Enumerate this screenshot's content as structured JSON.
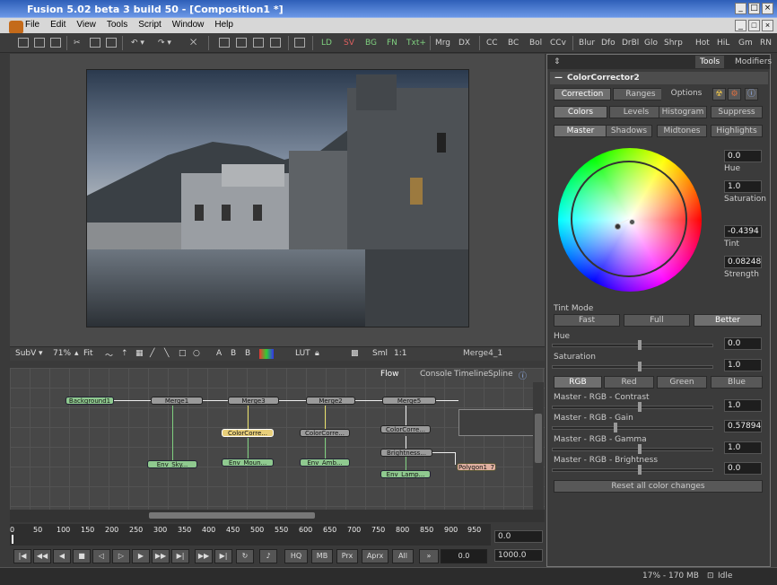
{
  "window": {
    "title": "Fusion 5.02 beta 3 build 50 - [Composition1 *]"
  },
  "menu": [
    "File",
    "Edit",
    "View",
    "Tools",
    "Script",
    "Window",
    "Help"
  ],
  "toolbar": {
    "tools": [
      "LD",
      "SV",
      "BG",
      "FN",
      "Txt+",
      "Mrg",
      "DX",
      "CC",
      "BC",
      "Bol",
      "CCv",
      "Blur",
      "Dfo",
      "DrBl",
      "Glo",
      "Shrp",
      "Hot",
      "HiL",
      "Gm",
      "RN"
    ],
    "colors": {
      "LD": "#7fd07f",
      "SV": "#e06060",
      "BG": "#7fd07f",
      "FN": "#7fd07f",
      "Txt+": "#7fd07f"
    }
  },
  "viewer": {
    "subview": "SubV",
    "zoom": "71%",
    "fit": "Fit",
    "lut": "LUT",
    "sml": "Sml",
    "ratio": "1:1",
    "channels": [
      "A",
      "B",
      "B"
    ],
    "node_label": "Merge4_1"
  },
  "flow_tabs": [
    "Flow",
    "Console",
    "Timeline",
    "Spline"
  ],
  "nodes": {
    "background": "Background1",
    "merge1": "Merge1",
    "merge3": "Merge3",
    "merge2": "Merge2",
    "merge5": "Merge5",
    "env_sky": "Env_Sky...",
    "colorcorr2": "ColorCorre...",
    "env_moun": "Env_Moun...",
    "colorcorr1": "ColorCorre...",
    "env_amb": "Env_Amb...",
    "colorcorr3": "ColorCorre...",
    "brightness": "Brightness...",
    "env_lamp": "Env_Lamp...",
    "polygon": "Polygon1_7"
  },
  "timeline": {
    "ticks": [
      "0",
      "50",
      "100",
      "150",
      "200",
      "250",
      "300",
      "350",
      "400",
      "450",
      "500",
      "550",
      "600",
      "650",
      "700",
      "750",
      "800",
      "850",
      "900",
      "950"
    ],
    "current_field": "0.0",
    "start_field": "0.0",
    "end_field": "1000.0",
    "buttons": [
      "HQ",
      "MB",
      "Prx",
      "Aprx",
      "All"
    ]
  },
  "panel": {
    "tabs": [
      "Tools",
      "Modifiers"
    ],
    "tool_name": "ColorCorrector2",
    "sub_tabs": [
      "Correction",
      "Ranges",
      "Options"
    ],
    "mode_buttons": [
      "Colors",
      "Levels",
      "Histogram",
      "Suppress"
    ],
    "range_buttons": [
      "Master",
      "Shadows",
      "Midtones",
      "Highlights"
    ],
    "fields": [
      {
        "value": "0.0",
        "label": "Hue"
      },
      {
        "value": "1.0",
        "label": "Saturation"
      },
      {
        "value": "-0.4394",
        "label": "Tint"
      },
      {
        "value": "0.08248",
        "label": "Strength"
      }
    ],
    "tint_mode": {
      "label": "Tint Mode",
      "options": [
        "Fast",
        "Full",
        "Better"
      ]
    },
    "hue": {
      "label": "Hue",
      "value": "0.0"
    },
    "saturation": {
      "label": "Saturation",
      "value": "1.0"
    },
    "channel_buttons": [
      "RGB",
      "Red",
      "Green",
      "Blue"
    ],
    "contrast": {
      "label": "Master - RGB - Contrast",
      "value": "1.0"
    },
    "gain": {
      "label": "Master - RGB - Gain",
      "value": "0.57894"
    },
    "gamma": {
      "label": "Master - RGB - Gamma",
      "value": "1.0"
    },
    "brightness": {
      "label": "Master - RGB - Brightness",
      "value": "0.0"
    },
    "reset": "Reset all color changes"
  },
  "status": {
    "memory": "17% - 170 MB",
    "state": "Idle"
  }
}
